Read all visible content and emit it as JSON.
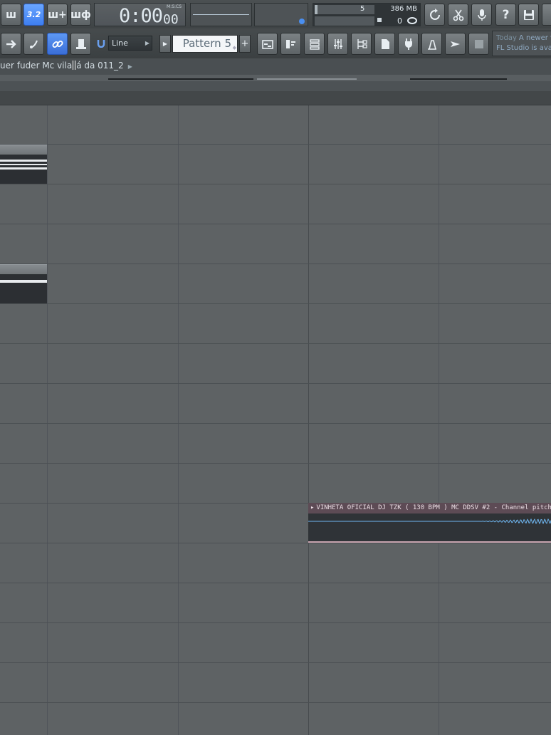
{
  "toolbar": {
    "time": "0:00",
    "time_cs": "00",
    "time_format": "M:S:CS",
    "cpu_value": "5",
    "cpu_percent": 5,
    "memory": "386 MB",
    "polyphony": "0",
    "snap": "Line",
    "pattern": "Pattern 5",
    "buttons_row1": [
      {
        "name": "tempo-button",
        "label": "ш"
      },
      {
        "name": "step-mode-button",
        "label": "3.2"
      },
      {
        "name": "add-pattern-button",
        "label": "ш+"
      },
      {
        "name": "loop-record-button",
        "label": "шф"
      }
    ]
  },
  "news": {
    "prefix": "Today",
    "line1": "A newer v",
    "line2": "FL Studio is avail"
  },
  "hint": {
    "text_before": "uer fuder Mc vila",
    "text_after": "á da 011_2"
  },
  "clip": {
    "title": "VINHETA OFICIAL DJ TZK ( 130 BPM ) MC DDSV #2 - Channel pitch (",
    "icon": "audio-clip-icon"
  },
  "colors": {
    "accent": "#4a8ff0",
    "clip_header": "#5d4b55",
    "grid_bg": "#5e6264"
  }
}
